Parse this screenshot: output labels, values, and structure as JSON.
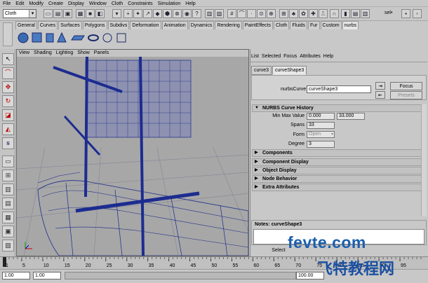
{
  "menubar": [
    "File",
    "Edit",
    "Modify",
    "Create",
    "Display",
    "Window",
    "Cloth",
    "Constraints",
    "Simulation",
    "Help"
  ],
  "status_line": {
    "mode": "Cloth",
    "sel_label": "sel•"
  },
  "shelf_tabs": [
    "General",
    "Curves",
    "Surfaces",
    "Polygons",
    "Subdivs",
    "Deformation",
    "Animation",
    "Dynamics",
    "Rendering",
    "PaintEffects",
    "Cloth",
    "Fluids",
    "Fur",
    "Custom",
    "nurbs"
  ],
  "shelf_active_tab": "nurbs",
  "viewport_menu": [
    "View",
    "Shading",
    "Lighting",
    "Show",
    "Panels"
  ],
  "attr_editor": {
    "menu": [
      "List",
      "Selected",
      "Focus",
      "Attributes",
      "Help"
    ],
    "tabs": [
      "curve3",
      "curveShape3"
    ],
    "active_tab": "curveShape3",
    "node_label": "nurbsCurve:",
    "node_value": "curveShape3",
    "focus_label": "Focus",
    "presets_label": "Presets",
    "history": {
      "title": "NURBS Curve History",
      "min_max_label": "Min Max Value",
      "min_value": "0.000",
      "max_value": "33.000",
      "spans_label": "Spans",
      "spans_value": "33",
      "form_label": "Form",
      "form_value": "Open",
      "degree_label": "Degree",
      "degree_value": "3"
    },
    "sections": [
      "Components",
      "Component Display",
      "Object Display",
      "Node Behavior",
      "Extra Attributes"
    ],
    "notes_label": "Notes: curveShape3",
    "select_label": "Select"
  },
  "timeline": {
    "ticks": [
      "1",
      "5",
      "10",
      "15",
      "20",
      "25",
      "30",
      "35",
      "40",
      "45",
      "50",
      "55",
      "60",
      "65",
      "70",
      "75",
      "80",
      "85",
      "90",
      "95"
    ]
  },
  "range": {
    "start": "1.00",
    "current": "1.00",
    "end_value": "100.00"
  },
  "watermark": {
    "line1": "fevte.com",
    "line2": "飞特教程网"
  },
  "colors": {
    "wire": "#1a2a8a",
    "viewport_bg": "#a7a7a7",
    "ui_gray": "#c8c8c8"
  }
}
